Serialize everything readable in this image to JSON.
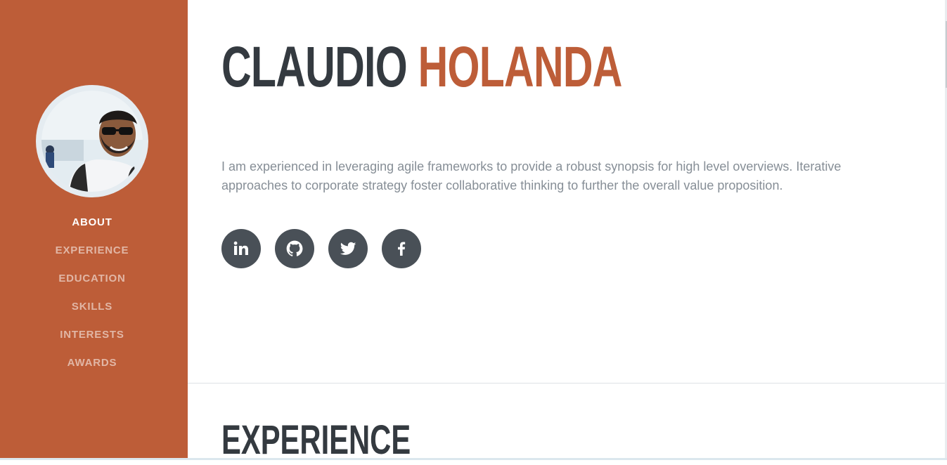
{
  "sidebar": {
    "avatar_alt": "Profile photo",
    "nav": [
      {
        "label": "ABOUT",
        "active": true
      },
      {
        "label": "EXPERIENCE",
        "active": false
      },
      {
        "label": "EDUCATION",
        "active": false
      },
      {
        "label": "SKILLS",
        "active": false
      },
      {
        "label": "INTERESTS",
        "active": false
      },
      {
        "label": "AWARDS",
        "active": false
      }
    ]
  },
  "about": {
    "first_name": "CLAUDIO",
    "last_name": "HOLANDA",
    "intro": "I am experienced in leveraging agile frameworks to provide a robust synopsis for high level overviews. Iterative approaches to corporate strategy foster collaborative thinking to further the overall value proposition.",
    "socials": [
      {
        "icon": "linkedin-icon"
      },
      {
        "icon": "github-icon"
      },
      {
        "icon": "twitter-icon"
      },
      {
        "icon": "facebook-icon"
      }
    ]
  },
  "experience": {
    "title": "EXPERIENCE"
  },
  "colors": {
    "primary": "#bd5d38",
    "heading": "#343a40",
    "text": "#868e96",
    "icon_bg": "#495057"
  }
}
